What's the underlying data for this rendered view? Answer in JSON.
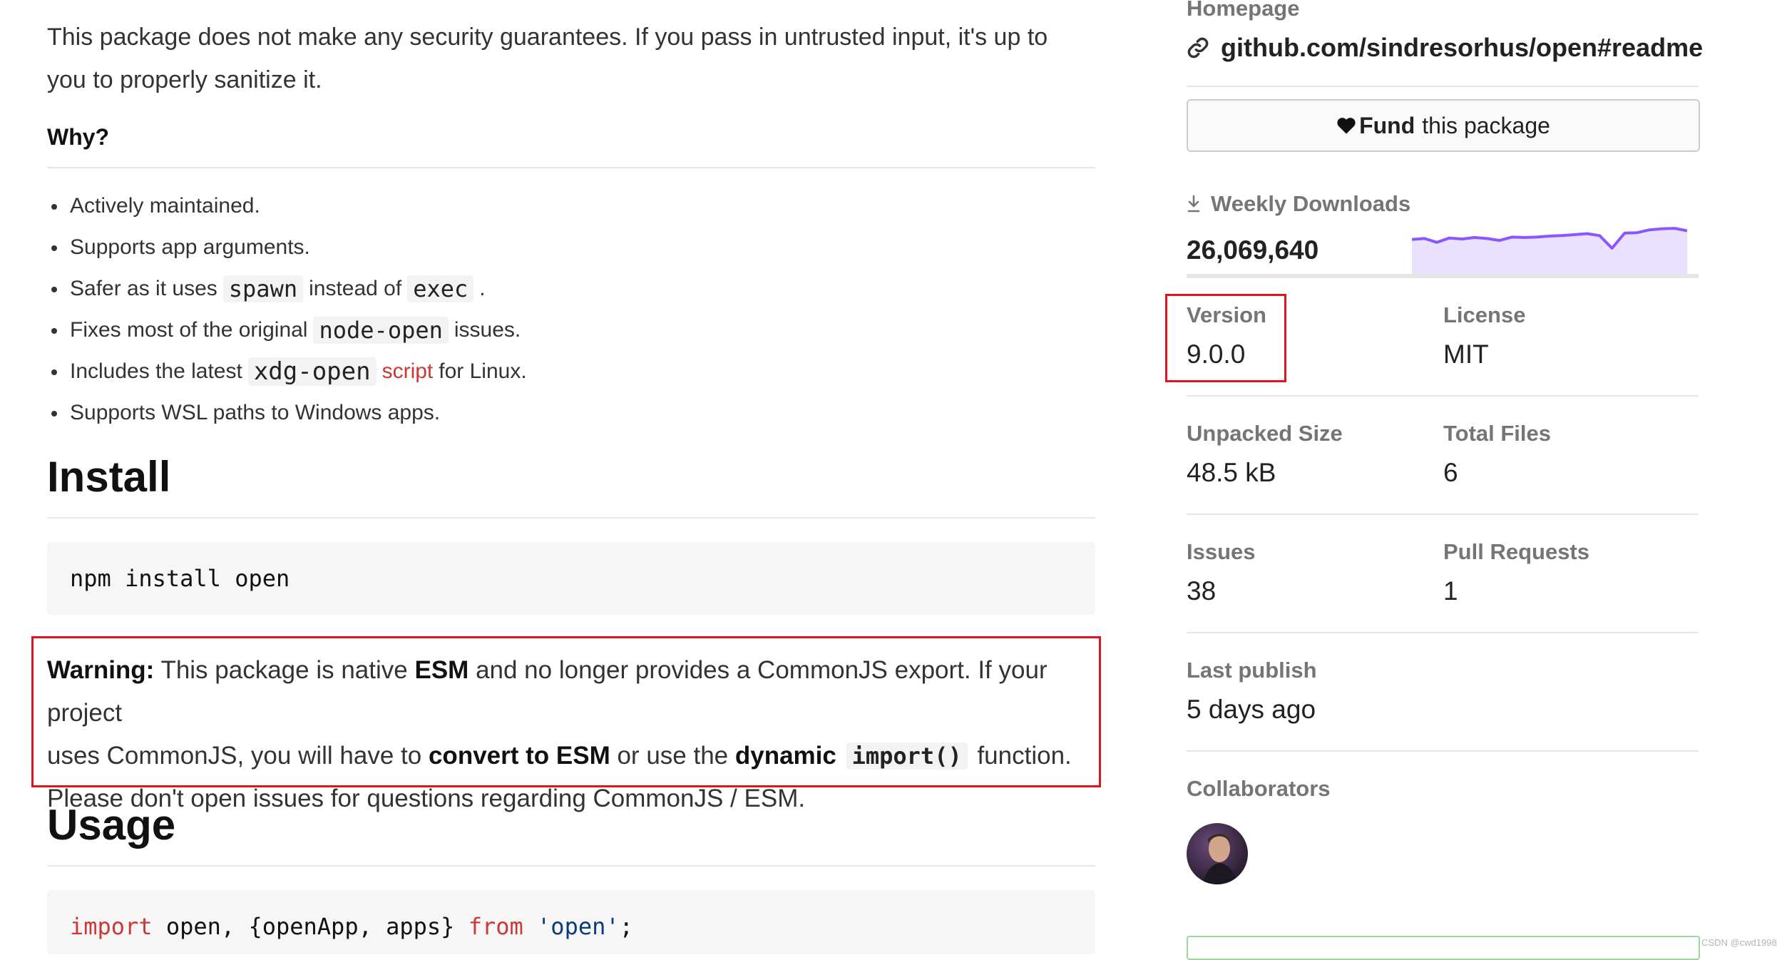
{
  "readme": {
    "security_note": "This package does not make any security guarantees. If you pass in untrusted input, it's up to you to properly sanitize it.",
    "why_heading": "Why?",
    "features": {
      "f1": "Actively maintained.",
      "f2": "Supports app arguments.",
      "f3_a": "Safer as it uses",
      "f3_code1": "spawn",
      "f3_b": "instead of",
      "f3_code2": "exec",
      "f3_c": ".",
      "f4_a": "Fixes most of the original",
      "f4_code": "node-open",
      "f4_b": "issues.",
      "f5_a": "Includes the latest",
      "f5_code": "xdg-open",
      "f5_link": "script",
      "f5_b": "for Linux.",
      "f6": "Supports WSL paths to Windows apps."
    },
    "install_heading": "Install",
    "install_command": "npm install open",
    "warning": {
      "label": "Warning:",
      "t1": "This package is native",
      "link_esm": "ESM",
      "t2": "and no longer provides a CommonJS export. If your project",
      "t3": "uses CommonJS, you will have to",
      "link_convert": "convert to ESM",
      "t4": "or use the",
      "link_dynamic": "dynamic",
      "code_import": "import()",
      "t5": "function.",
      "t6": "Please don't open issues for questions regarding CommonJS / ESM."
    },
    "usage_heading": "Usage",
    "usage_code": {
      "kw_import": "import",
      "middle": " open, {openApp, apps} ",
      "kw_from": "from",
      "string": "'open'",
      "end": ";"
    }
  },
  "sidebar": {
    "homepage_label": "Homepage",
    "homepage_link": "github.com/sindresorhus/open#readme",
    "fund_strong": "Fund",
    "fund_rest": "this package",
    "downloads_label": "Weekly Downloads",
    "downloads_value": "26,069,640",
    "sparkline_values": [
      0.68,
      0.7,
      0.62,
      0.71,
      0.69,
      0.72,
      0.7,
      0.66,
      0.73,
      0.72,
      0.73,
      0.75,
      0.76,
      0.78,
      0.8,
      0.76,
      0.5,
      0.81,
      0.82,
      0.88,
      0.9,
      0.91,
      0.86
    ],
    "version_label": "Version",
    "version_value": "9.0.0",
    "license_label": "License",
    "license_value": "MIT",
    "unpacked_label": "Unpacked Size",
    "unpacked_value": "48.5 kB",
    "total_files_label": "Total Files",
    "total_files_value": "6",
    "issues_label": "Issues",
    "issues_value": "38",
    "pull_requests_label": "Pull Requests",
    "pull_requests_value": "1",
    "last_publish_label": "Last publish",
    "last_publish_value": "5 days ago",
    "collaborators_label": "Collaborators"
  },
  "watermark": "CSDN @cwd1998",
  "colors": {
    "npm_red": "#cb3837",
    "annotation_red": "#e0141e",
    "sparkline_line": "#8956ff",
    "sparkline_fill": "#e9e1ff",
    "code_string": "#0b3c78"
  },
  "icons": {
    "homepage": "link-icon",
    "fund": "heart-icon",
    "downloads": "download-icon"
  }
}
